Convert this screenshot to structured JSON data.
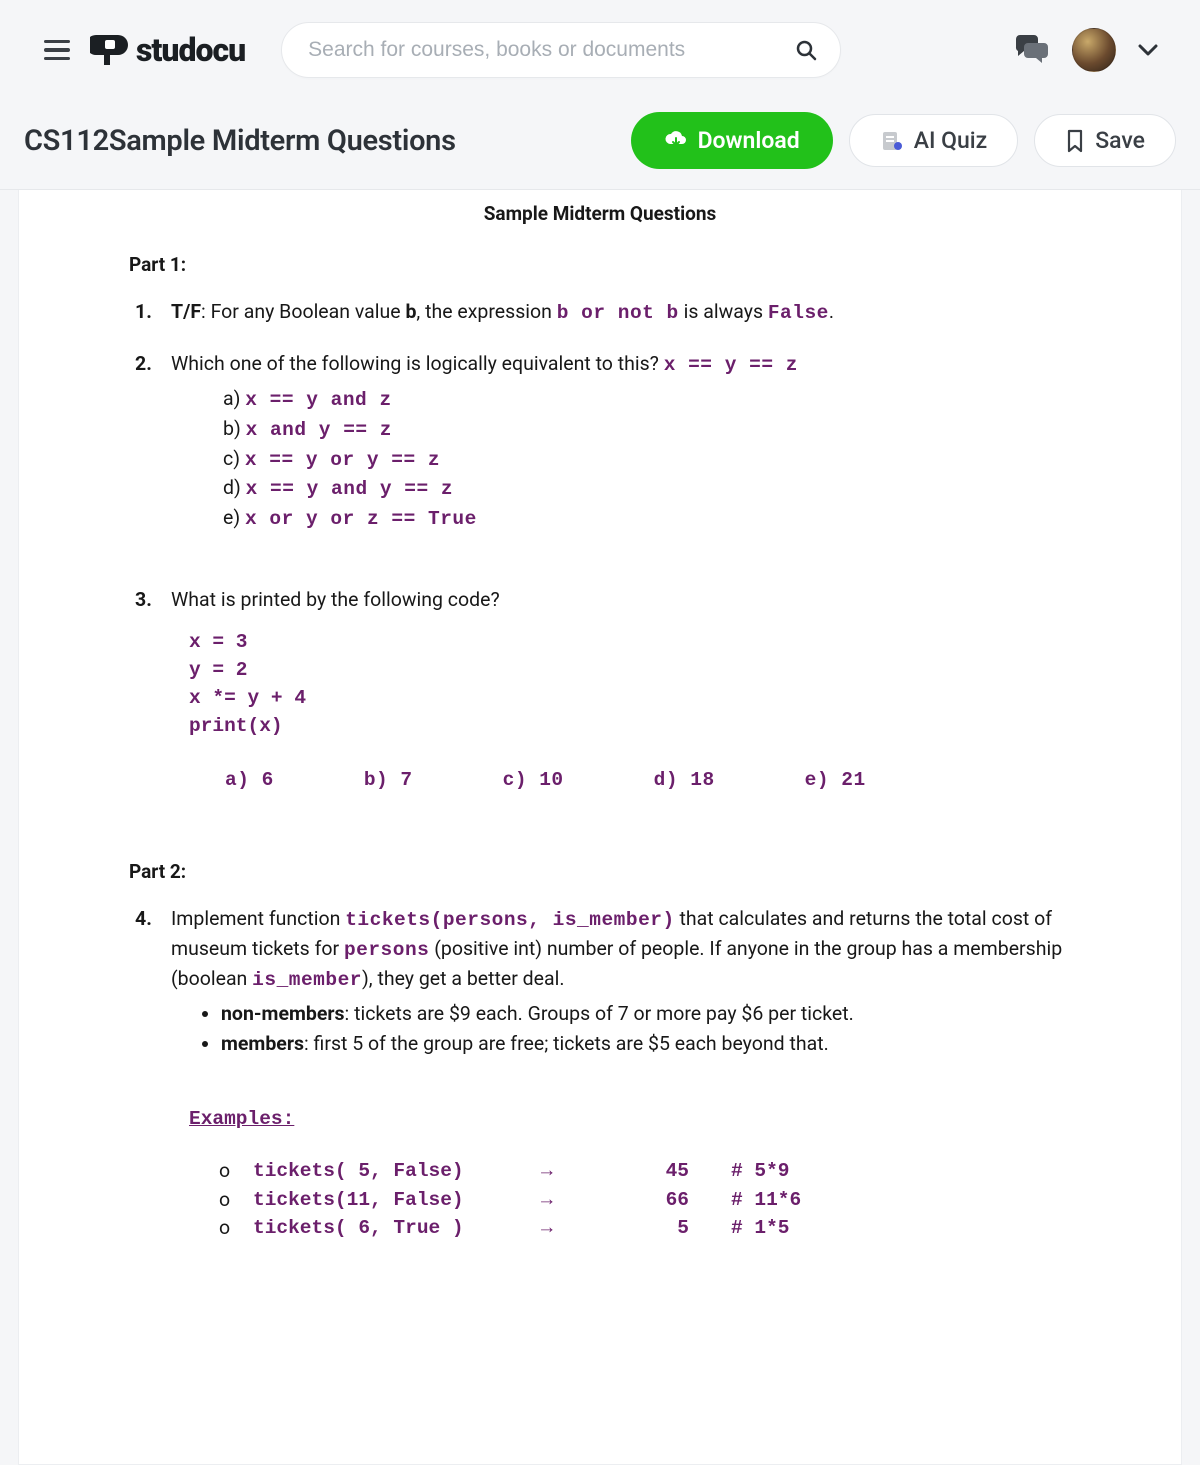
{
  "header": {
    "logo_text": "studocu",
    "search_placeholder": "Search for courses, books or documents"
  },
  "titlebar": {
    "page_title": "CS112Sample Midterm Questions",
    "download_label": "Download",
    "aiquiz_label": "AI Quiz",
    "save_label": "Save"
  },
  "doc": {
    "title": "Sample Midterm Questions",
    "part1_label": "Part 1:",
    "q1": {
      "num": "1.",
      "tf": "T/F",
      "before_b": ":  For any Boolean value ",
      "b1": "b",
      "mid": ", the expression   ",
      "expr": "b or not b",
      "after": "   is always ",
      "false_kw": "False",
      "end": "."
    },
    "q2": {
      "num": "2.",
      "text": "Which one of the following is logically equivalent to this?   ",
      "expr": "x == y == z",
      "opts": {
        "a_label": "a)  ",
        "a_code": "x == y and z",
        "b_label": "b)  ",
        "b_code": "x and y == z",
        "c_label": "c)  ",
        "c_code": "x == y or y == z",
        "d_label": "d)  ",
        "d_code": "x == y and y == z",
        "e_label": "e)  ",
        "e_code": "x or y or z == True"
      }
    },
    "q3": {
      "num": "3.",
      "text": "What is printed by the following code?",
      "code": "x = 3\ny = 2\nx *= y + 4\nprint(x)",
      "ans_a": "a) 6",
      "ans_b": "b) 7",
      "ans_c": "c) 10",
      "ans_d": "d) 18",
      "ans_e": "e) 21"
    },
    "part2_label": "Part 2:",
    "q4": {
      "num": "4.",
      "line1_a": "Implement function ",
      "sig": "tickets(persons, is_member)",
      "line1_b": " that calculates and returns the total cost of museum tickets for ",
      "persons_kw": "persons",
      "line1_c": " (positive int) number of people. If anyone in the group has a membership (boolean ",
      "ismember_kw": "is_member",
      "line1_d": "), they get a better deal.",
      "bullet1_bold": "non-members",
      "bullet1_rest": ": tickets are $9 each. Groups of 7 or more pay $6 per ticket.",
      "bullet2_bold": "members",
      "bullet2_rest": ": first 5 of the group are free; tickets are $5 each  beyond that.",
      "examples_label": "Examples:",
      "ex": [
        {
          "call": "tickets( 5, False)",
          "arrow": "→",
          "res": "45",
          "comment": "# 5*9"
        },
        {
          "call": "tickets(11, False)",
          "arrow": "→",
          "res": "66",
          "comment": "# 11*6"
        },
        {
          "call": "tickets( 6, True )",
          "arrow": "→",
          "res": "5",
          "comment": "# 1*5"
        }
      ]
    }
  }
}
